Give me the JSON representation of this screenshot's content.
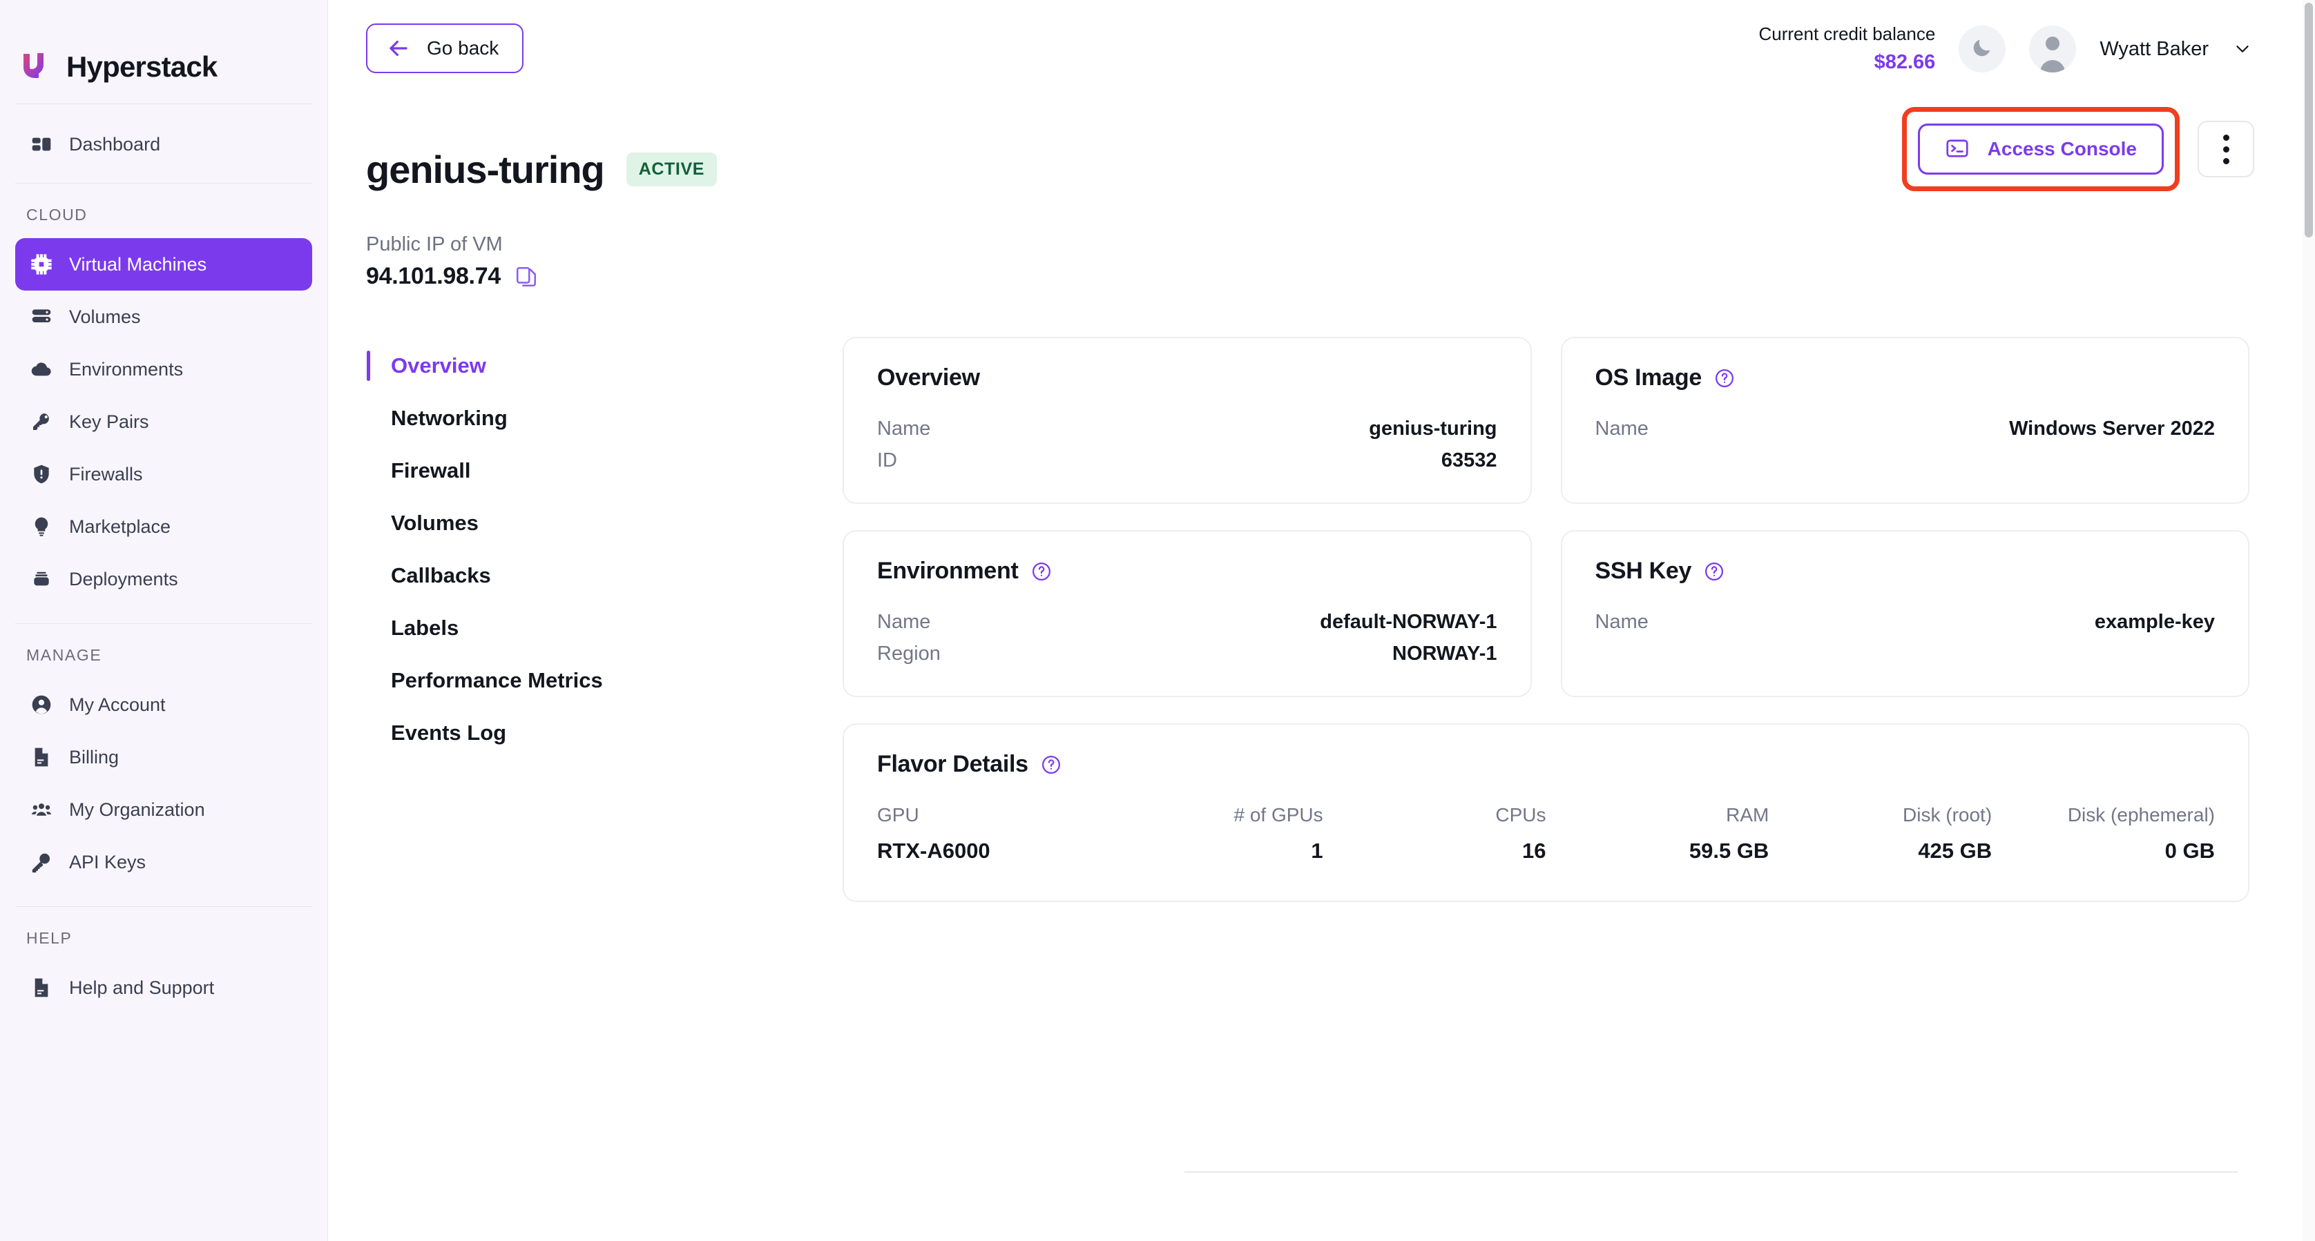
{
  "brand": {
    "name": "Hyperstack"
  },
  "sidebar": {
    "primary": [
      {
        "label": "Dashboard",
        "icon": "dashboard-icon",
        "active": false
      }
    ],
    "sections": [
      {
        "label": "CLOUD",
        "items": [
          {
            "label": "Virtual Machines",
            "icon": "cpu-chip-icon",
            "active": true
          },
          {
            "label": "Volumes",
            "icon": "database-icon",
            "active": false
          },
          {
            "label": "Environments",
            "icon": "cloud-icon",
            "active": false
          },
          {
            "label": "Key Pairs",
            "icon": "key-icon",
            "active": false
          },
          {
            "label": "Firewalls",
            "icon": "shield-icon",
            "active": false
          },
          {
            "label": "Marketplace",
            "icon": "lightbulb-icon",
            "active": false
          },
          {
            "label": "Deployments",
            "icon": "stack-icon",
            "active": false
          }
        ]
      },
      {
        "label": "MANAGE",
        "items": [
          {
            "label": "My Account",
            "icon": "user-circle-icon",
            "active": false
          },
          {
            "label": "Billing",
            "icon": "document-icon",
            "active": false
          },
          {
            "label": "My Organization",
            "icon": "users-group-icon",
            "active": false
          },
          {
            "label": "API Keys",
            "icon": "key-outline-icon",
            "active": false
          }
        ]
      },
      {
        "label": "HELP",
        "items": [
          {
            "label": "Help and Support",
            "icon": "document-icon",
            "active": false
          }
        ]
      }
    ]
  },
  "topbar": {
    "go_back_label": "Go back",
    "credit_label": "Current credit balance",
    "credit_value": "$82.66",
    "theme_toggle_icon": "moon-icon",
    "user_name": "Wyatt Baker",
    "chevron_icon": "chevron-down-icon"
  },
  "actions": {
    "access_console_label": "Access Console",
    "access_console_icon": "terminal-icon",
    "kebab_icon": "more-vertical-icon",
    "highlight_color": "#f03e1e"
  },
  "page": {
    "title": "genius-turing",
    "status_badge": "ACTIVE",
    "ip_label": "Public IP of VM",
    "ip_value": "94.101.98.74",
    "copy_icon": "copy-icon"
  },
  "subnav": [
    {
      "label": "Overview",
      "active": true
    },
    {
      "label": "Networking",
      "active": false
    },
    {
      "label": "Firewall",
      "active": false
    },
    {
      "label": "Volumes",
      "active": false
    },
    {
      "label": "Callbacks",
      "active": false
    },
    {
      "label": "Labels",
      "active": false
    },
    {
      "label": "Performance Metrics",
      "active": false
    },
    {
      "label": "Events Log",
      "active": false
    }
  ],
  "cards": {
    "overview": {
      "title": "Overview",
      "has_help": false,
      "rows": [
        {
          "key": "Name",
          "value": "genius-turing"
        },
        {
          "key": "ID",
          "value": "63532"
        }
      ]
    },
    "os_image": {
      "title": "OS Image",
      "has_help": true,
      "rows": [
        {
          "key": "Name",
          "value": "Windows Server 2022"
        }
      ]
    },
    "environment": {
      "title": "Environment",
      "has_help": true,
      "rows": [
        {
          "key": "Name",
          "value": "default-NORWAY-1"
        },
        {
          "key": "Region",
          "value": "NORWAY-1"
        }
      ]
    },
    "ssh_key": {
      "title": "SSH Key",
      "has_help": true,
      "rows": [
        {
          "key": "Name",
          "value": "example-key"
        }
      ]
    },
    "flavor_details": {
      "title": "Flavor Details",
      "has_help": true,
      "columns": [
        {
          "header": "GPU",
          "value": "RTX-A6000"
        },
        {
          "header": "# of GPUs",
          "value": "1"
        },
        {
          "header": "CPUs",
          "value": "16"
        },
        {
          "header": "RAM",
          "value": "59.5 GB"
        },
        {
          "header": "Disk (root)",
          "value": "425 GB"
        },
        {
          "header": "Disk (ephemeral)",
          "value": "0 GB"
        }
      ]
    }
  },
  "colors": {
    "accent": "#7c3aed",
    "sidebar_bg": "#f8f6fc",
    "badge_bg": "#dff3e6",
    "badge_text": "#11603a",
    "highlight": "#f03e1e"
  }
}
